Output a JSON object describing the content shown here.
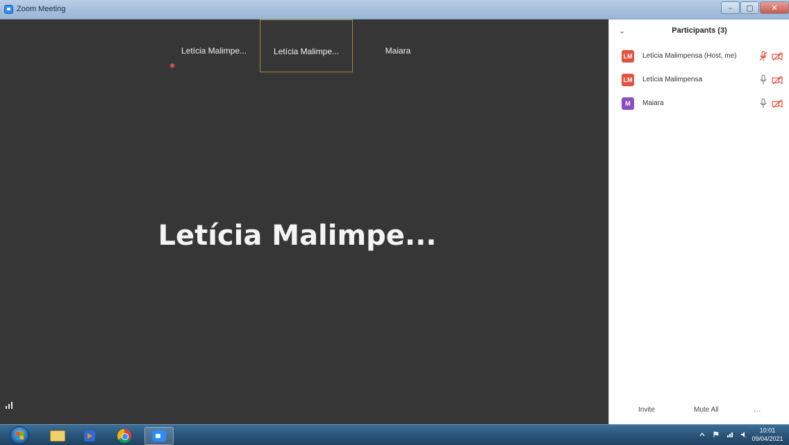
{
  "window": {
    "title": "Zoom Meeting",
    "controls": {
      "minimize": "–",
      "maximize": "▢",
      "close": "✕"
    }
  },
  "video": {
    "thumbnails": [
      {
        "label": "Letícia  Malimpe..."
      },
      {
        "label": "Letícia  Malimpe..."
      },
      {
        "label": "Maiara"
      }
    ],
    "active_speaker": "Letícia  Malimpe...",
    "signal_label": "signal-strength"
  },
  "participants_panel": {
    "title": "Participants (3)",
    "participants": [
      {
        "initials": "LM",
        "name": "Letícia Malimpensa (Host, me)",
        "avatar_color": "#e0533f",
        "mic": "muted",
        "video": "off"
      },
      {
        "initials": "LM",
        "name": "Letícia Malimpensa",
        "avatar_color": "#e0533f",
        "mic": "on",
        "video": "off"
      },
      {
        "initials": "M",
        "name": "Maiara",
        "avatar_color": "#8a4fbf",
        "mic": "on",
        "video": "off"
      }
    ],
    "footer": {
      "invite": "Invite",
      "mute_all": "Mute All",
      "more": "..."
    }
  },
  "taskbar": {
    "apps": [
      "start",
      "file-explorer",
      "media-player",
      "chrome",
      "zoom"
    ],
    "clock": {
      "time": "10:01",
      "date": "09/04/2021"
    }
  },
  "colors": {
    "video_bg": "#363636",
    "accent_red": "#e0533f",
    "accent_purple": "#8a4fbf"
  }
}
